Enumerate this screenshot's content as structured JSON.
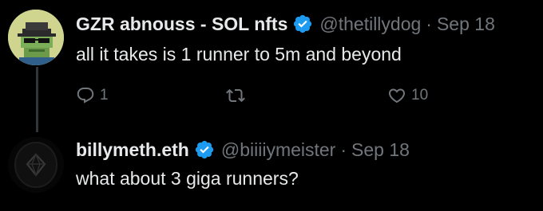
{
  "tweets": [
    {
      "display_name": "GZR abnouss - SOL nfts",
      "handle": "@thetillydog",
      "separator": "·",
      "date": "Sep 18",
      "text": "all it takes is 1 runner to 5m and beyond",
      "verified": true,
      "actions": {
        "reply_count": "1",
        "retweet_count": "",
        "like_count": "10"
      }
    },
    {
      "display_name": "billymeth.eth",
      "handle": "@biiiiymeister",
      "separator": "·",
      "date": "Sep 18",
      "text": "what about 3 giga runners?",
      "verified": true
    }
  ],
  "icons": {
    "verified": "verified-badge-icon",
    "reply": "reply-icon",
    "retweet": "retweet-icon",
    "like": "heart-icon"
  },
  "colors": {
    "background": "#000000",
    "text": "#e7e9ea",
    "secondary": "#71767b",
    "verified": "#1d9bf0",
    "thread_line": "#333639"
  }
}
